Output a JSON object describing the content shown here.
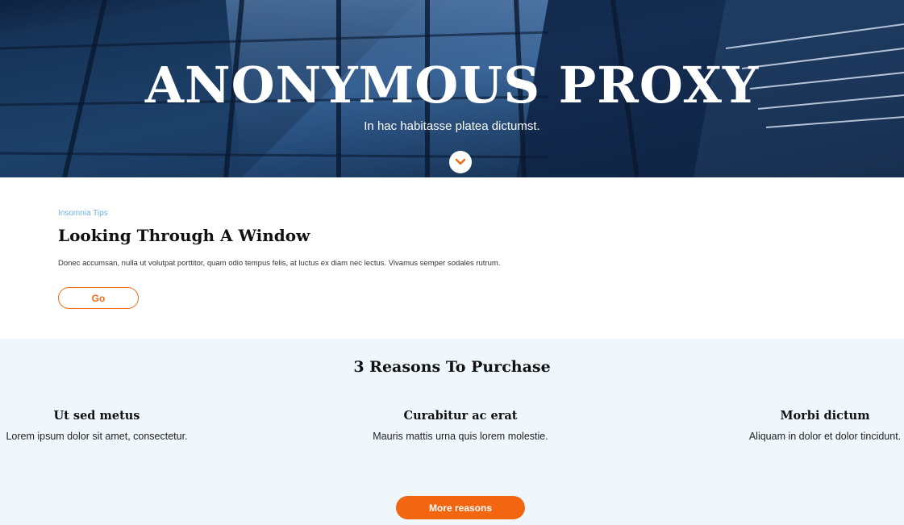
{
  "hero": {
    "title": "ANONYMOUS PROXY",
    "subtitle": "In hac habitasse platea dictumst.",
    "scroll_icon": "chevron-down-icon"
  },
  "intro": {
    "eyebrow": "Insomnia Tips",
    "title": "Looking Through A Window",
    "text": "Donec accumsan, nulla ut volutpat porttitor, quam odio tempus felis, at luctus ex diam nec lectus. Vivamus semper sodales rutrum.",
    "button_label": "Go"
  },
  "reasons": {
    "title": "3 Reasons To Purchase",
    "items": [
      {
        "title": "Ut sed metus",
        "text": "Lorem ipsum dolor sit amet, consectetur."
      },
      {
        "title": "Curabitur ac erat",
        "text": "Mauris mattis urna quis lorem molestie."
      },
      {
        "title": "Morbi dictum",
        "text": "Aliquam in dolor et dolor tincidunt."
      }
    ],
    "button_label": "More reasons"
  },
  "colors": {
    "accent": "#f26611",
    "eyebrow": "#6fb3e0",
    "reasons_bg": "#eff7fd"
  }
}
